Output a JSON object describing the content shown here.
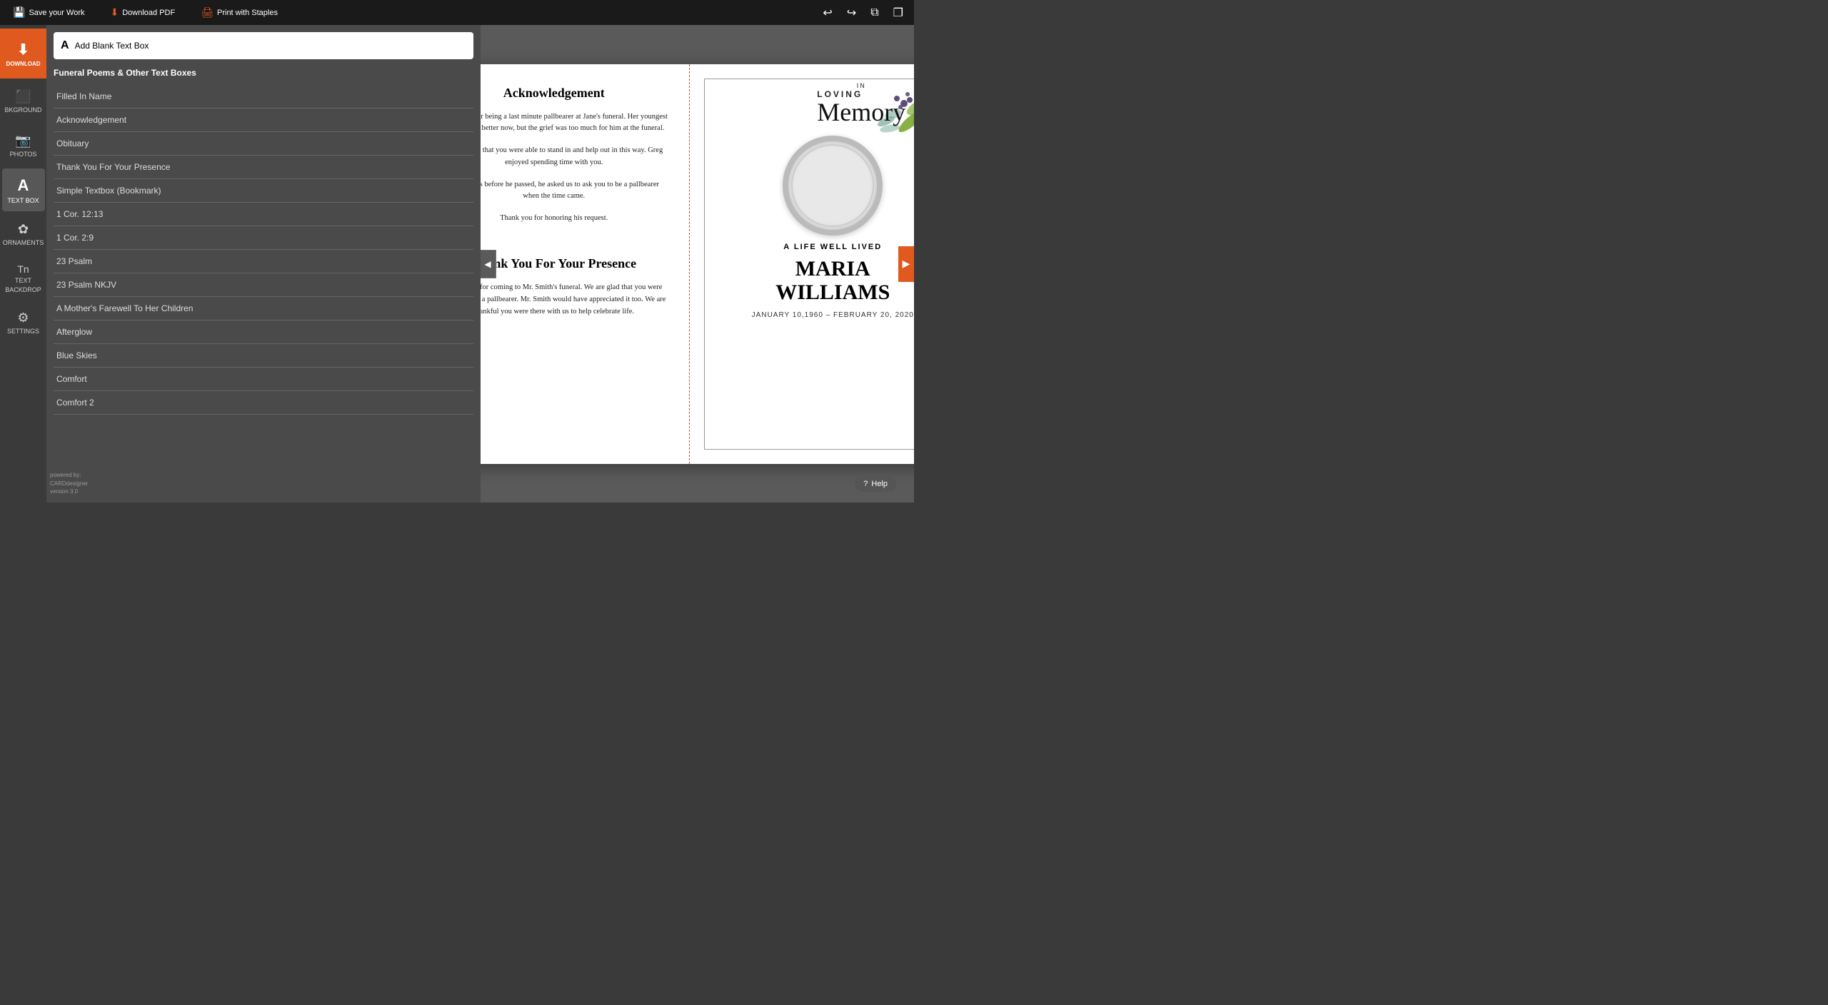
{
  "topbar": {
    "save_label": "Save your Work",
    "download_label": "Download PDF",
    "print_label": "Print with Staples"
  },
  "sidebar_icons": [
    {
      "id": "download",
      "label": "DOWNLOAD",
      "symbol": "⬇"
    },
    {
      "id": "background",
      "label": "BKGROUND",
      "symbol": "🖼"
    },
    {
      "id": "photos",
      "label": "PHOTOS",
      "symbol": "📷"
    },
    {
      "id": "textbox",
      "label": "TEXT BOX",
      "symbol": "A"
    },
    {
      "id": "ornaments",
      "label": "ORNAMENTS",
      "symbol": "✿"
    },
    {
      "id": "text-backdrop",
      "label": "TEXT BACKDROP",
      "symbol": "📝"
    },
    {
      "id": "settings",
      "label": "SETTINGS",
      "symbol": "⚙"
    }
  ],
  "panel": {
    "add_textbox_label": "Add Blank Text Box",
    "section_title": "Funeral Poems & Other Text Boxes",
    "poems": [
      "Filled In Name",
      "Acknowledgement",
      "Obituary",
      "Thank You For Your Presence",
      "Simple Textbox (Bookmark)",
      "1 Cor. 12:13",
      "1 Cor. 2:9",
      "23 Psalm",
      "23 Psalm NKJV",
      "A Mother's Farewell To Her Children",
      "Afterglow",
      "Blue Skies",
      "Comfort",
      "Comfort 2"
    ]
  },
  "card": {
    "left": {
      "section1_title": "Acknowledgement",
      "section1_text1": "Thank you for being a last minute pallbearer at Jane's funeral. Her youngest son is doing better now, but the grief was too much for him at the funeral.",
      "section1_text2": "We are glad that you were able to stand in and help out in this way. Greg enjoyed spending time with you.",
      "section1_text3": "A few days before he passed, he asked us to ask you to be a pallbearer when the time came.",
      "section1_text4": "Thank you for honoring his request.",
      "section2_title": "Thank You For Your Presence",
      "section2_text1": "Thank you for coming to Mr. Smith's funeral. We are glad that you were willing to be a pallbearer. Mr. Smith would have appreciated it too. We are thankful you were there with us to help celebrate life."
    },
    "right": {
      "in_loving_top": "IN",
      "in_loving_script": "Memory",
      "in_loving_loving": "LOVING",
      "life_well_lived": "A LIFE WELL LIVED",
      "person_name_line1": "MARIA",
      "person_name_line2": "WILLIAMS",
      "dates": "JANUARY 10,1960 – FEBRUARY 20, 2020"
    }
  },
  "help_label": "Help",
  "powered_by": "powered by:\nCARDdesigner\nversion 3.0"
}
